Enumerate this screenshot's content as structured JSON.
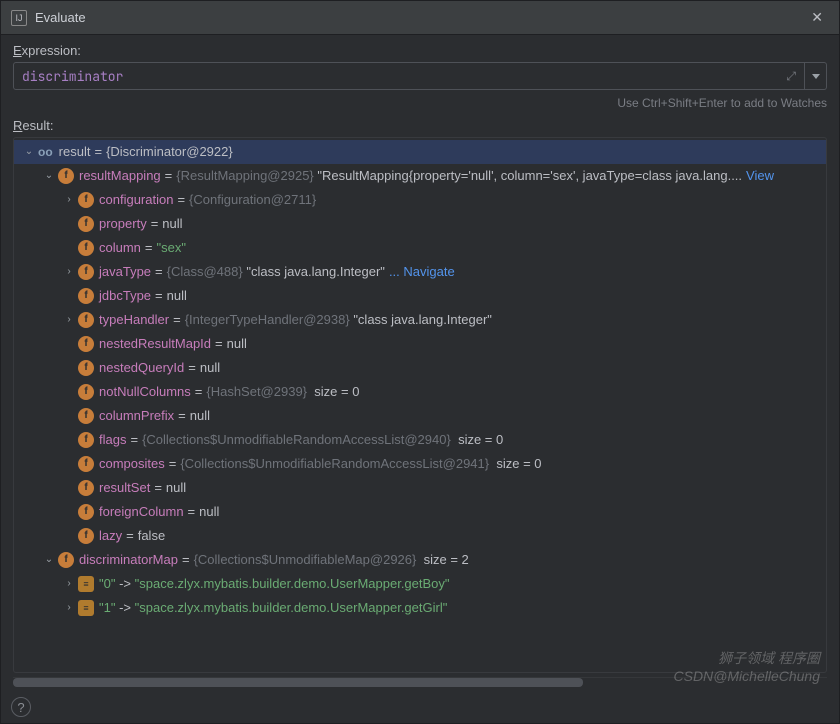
{
  "window": {
    "title": "Evaluate"
  },
  "expression": {
    "label_prefix": "E",
    "label_rest": "xpression:",
    "value": "discriminator",
    "hint": "Use Ctrl+Shift+Enter to add to Watches"
  },
  "result": {
    "label_prefix": "R",
    "label_rest": "esult:"
  },
  "tree": {
    "root": {
      "name": "result",
      "value": "{Discriminator@2922}"
    },
    "resultMapping": {
      "name": "resultMapping",
      "obj": "{ResultMapping@2925}",
      "text": "\"ResultMapping{property='null', column='sex', javaType=class java.lang....",
      "link": "View"
    },
    "configuration": {
      "name": "configuration",
      "obj": "{Configuration@2711}"
    },
    "property": {
      "name": "property",
      "value": "null"
    },
    "column": {
      "name": "column",
      "value": "\"sex\""
    },
    "javaType": {
      "name": "javaType",
      "obj": "{Class@488}",
      "text": "\"class java.lang.Integer\"",
      "link": "... Navigate"
    },
    "jdbcType": {
      "name": "jdbcType",
      "value": "null"
    },
    "typeHandler": {
      "name": "typeHandler",
      "obj": "{IntegerTypeHandler@2938}",
      "text": "\"class java.lang.Integer\""
    },
    "nestedResultMapId": {
      "name": "nestedResultMapId",
      "value": "null"
    },
    "nestedQueryId": {
      "name": "nestedQueryId",
      "value": "null"
    },
    "notNullColumns": {
      "name": "notNullColumns",
      "obj": "{HashSet@2939}",
      "size": "size = 0"
    },
    "columnPrefix": {
      "name": "columnPrefix",
      "value": "null"
    },
    "flags": {
      "name": "flags",
      "obj": "{Collections$UnmodifiableRandomAccessList@2940}",
      "size": "size = 0"
    },
    "composites": {
      "name": "composites",
      "obj": "{Collections$UnmodifiableRandomAccessList@2941}",
      "size": "size = 0"
    },
    "resultSet": {
      "name": "resultSet",
      "value": "null"
    },
    "foreignColumn": {
      "name": "foreignColumn",
      "value": "null"
    },
    "lazy": {
      "name": "lazy",
      "value": "false"
    },
    "discriminatorMap": {
      "name": "discriminatorMap",
      "obj": "{Collections$UnmodifiableMap@2926}",
      "size": "size = 2"
    },
    "entry0": {
      "key": "\"0\"",
      "arrow": "->",
      "value": "\"space.zlyx.mybatis.builder.demo.UserMapper.getBoy\""
    },
    "entry1": {
      "key": "\"1\"",
      "arrow": "->",
      "value": "\"space.zlyx.mybatis.builder.demo.UserMapper.getGirl\""
    }
  },
  "watermark": {
    "line1": "狮子领域 程序圈",
    "line2": "CSDN@MichelleChung"
  }
}
